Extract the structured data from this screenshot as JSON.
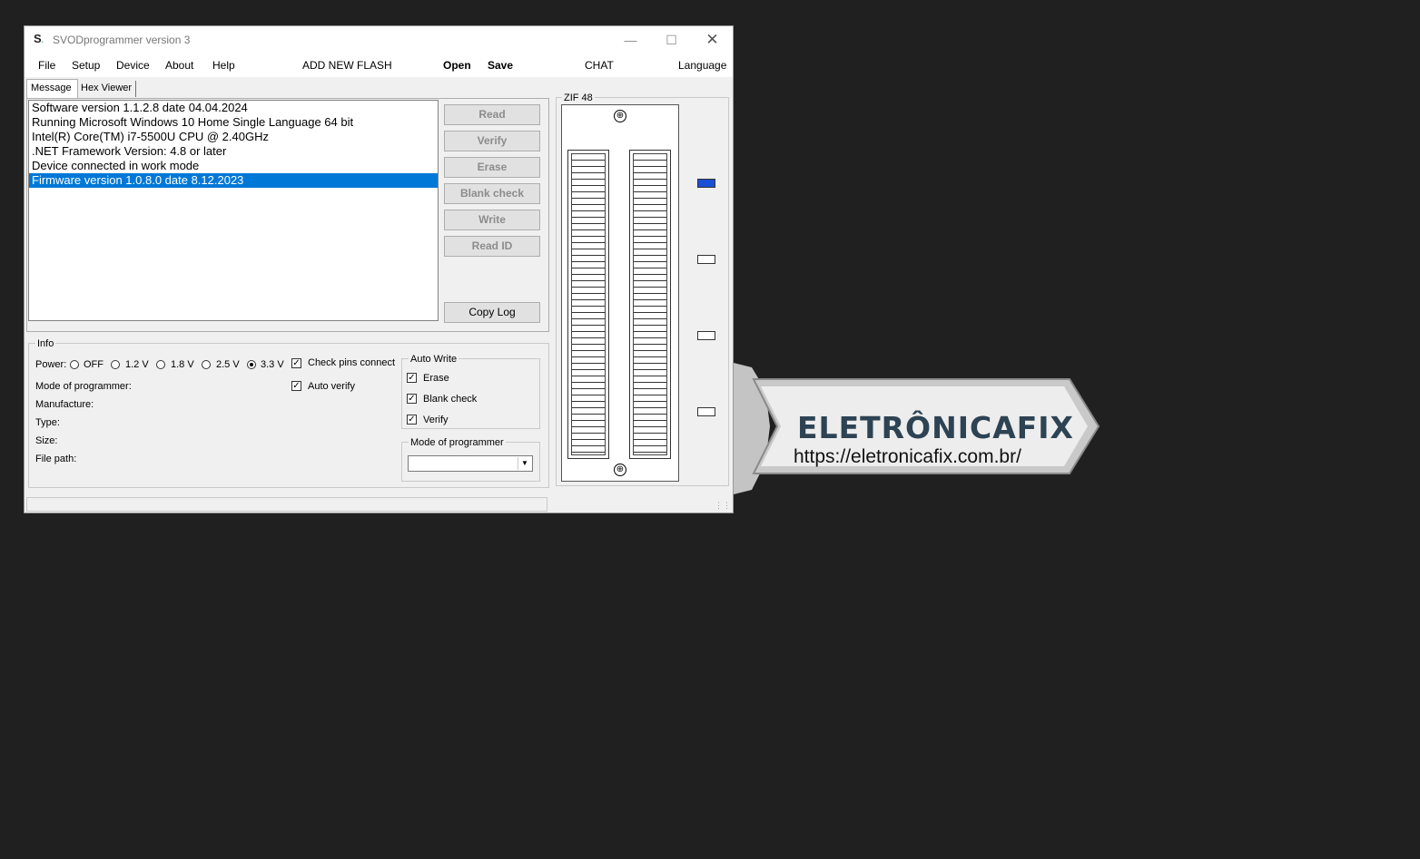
{
  "window": {
    "title": "SVODprogrammer version 3",
    "icon_letter": "S"
  },
  "menu": {
    "file": "File",
    "setup": "Setup",
    "device": "Device",
    "about": "About",
    "help": "Help",
    "add_new_flash": "ADD NEW FLASH",
    "open": "Open",
    "save": "Save",
    "chat": "CHAT",
    "language": "Language"
  },
  "tabs": {
    "message": "Message",
    "hex_viewer": "Hex Viewer"
  },
  "log": {
    "lines": [
      "Software version 1.1.2.8 date 04.04.2024",
      "Running Microsoft Windows 10 Home Single Language 64 bit",
      "Intel(R) Core(TM) i7-5500U CPU @ 2.40GHz",
      ".NET Framework Version: 4.8 or later",
      "Device connected in work mode",
      "Firmware version 1.0.8.0 date 8.12.2023"
    ],
    "selected_index": 5
  },
  "actions": {
    "read": "Read",
    "verify": "Verify",
    "erase": "Erase",
    "blank_check": "Blank check",
    "write": "Write",
    "read_id": "Read ID",
    "copy_log": "Copy Log"
  },
  "info": {
    "legend": "Info",
    "power_label": "Power:",
    "power_options": [
      "OFF",
      "1.2 V",
      "1.8 V",
      "2.5 V",
      "3.3 V"
    ],
    "power_selected": "3.3 V",
    "check_pins_connect": "Check pins connect",
    "auto_verify": "Auto verify",
    "mode_of_programmer_label": "Mode of programmer:",
    "manufacture_label": "Manufacture:",
    "type_label": "Type:",
    "size_label": "Size:",
    "file_path_label": "File path:"
  },
  "auto_write": {
    "legend": "Auto Write",
    "erase": "Erase",
    "blank_check": "Blank check",
    "verify": "Verify"
  },
  "mode_group": {
    "legend": "Mode of programmer",
    "selected": ""
  },
  "zif": {
    "legend": "ZIF 48"
  },
  "watermark": {
    "name": "ELETRÔNICAFIX",
    "url": "https://eletronicafix.com.br/"
  },
  "colors": {
    "selection": "#0078d7",
    "indicator_on": "#1a4fd6",
    "watermark_text": "#2d4353"
  }
}
